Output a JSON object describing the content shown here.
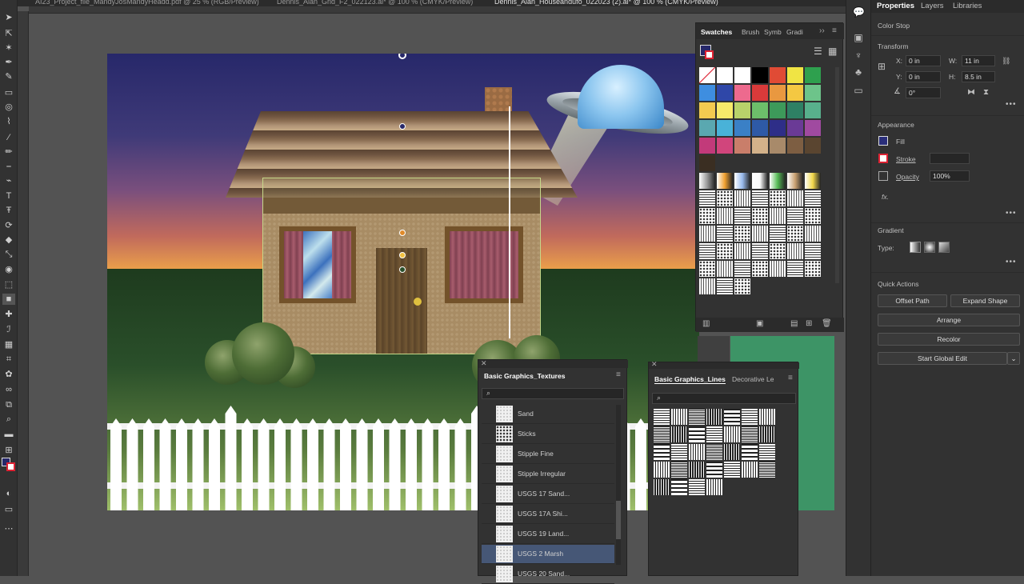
{
  "document_tabs": [
    {
      "label": "AI23_Project_file_MandyJosMandyHeadd.pdf @ 25 % (RGB/Preview)",
      "active": false
    },
    {
      "label": "Dennis_Alan_Grid_F2_022123.ai* @ 100 % (CMYK/Preview)",
      "active": false
    },
    {
      "label": "Dennis_Alan_Houseandufo_022023 (2).ai* @ 100 % (CMYK/Preview)",
      "active": true
    }
  ],
  "toolbar": {
    "tools": [
      "selection-tool",
      "direct-selection-tool",
      "magic-wand-tool",
      "pen-tool",
      "curvature-tool",
      "rectangle-tool",
      "ellipse-tool",
      "paintbrush-tool",
      "shaper-tool",
      "pencil-tool",
      "eraser-tool",
      "type-tool",
      "touch-type-tool",
      "rotate-tool",
      "scale-tool",
      "width-tool",
      "warp-tool",
      "free-transform-tool",
      "shape-builder-tool",
      "perspective-grid-tool",
      "mesh-tool",
      "gradient-tool",
      "eyedropper-tool",
      "blend-tool",
      "symbol-sprayer-tool",
      "column-graph-tool",
      "artboard-tool",
      "slice-tool",
      "hand-tool",
      "zoom-tool"
    ]
  },
  "properties_panel": {
    "tabs": [
      "Properties",
      "Layers",
      "Libraries"
    ],
    "selection_type": "Color Stop",
    "transform": {
      "title": "Transform",
      "x_label": "X:",
      "x_value": "0 in",
      "y_label": "Y:",
      "y_value": "0 in",
      "w_label": "W:",
      "w_value": "11 in",
      "h_label": "H:",
      "h_value": "8.5 in",
      "angle_value": "0°"
    },
    "appearance": {
      "title": "Appearance",
      "fill_label": "Fill",
      "stroke_label": "Stroke",
      "opacity_label": "Opacity",
      "opacity_value": "100%",
      "fx_label": "fx."
    },
    "gradient": {
      "title": "Gradient",
      "type_label": "Type:"
    },
    "quick_actions": {
      "title": "Quick Actions",
      "offset_path": "Offset Path",
      "expand_shape": "Expand Shape",
      "arrange": "Arrange",
      "recolor": "Recolor",
      "start_global_edit": "Start Global Edit"
    }
  },
  "swatches_panel": {
    "tabs": [
      "Swatches",
      "Brush",
      "Symb",
      "Gradi"
    ],
    "colors": [
      "#ffffff",
      "#ffffff",
      "#ffffff",
      "#000000",
      "#e04b35",
      "#f0e444",
      "#2ea04e",
      "#3e8ee0",
      "#2f47a8",
      "#ed6a8e",
      "#d93a3a",
      "#e99840",
      "#f4c842",
      "#6dc48a",
      "#f3cb50",
      "#f7ea6a",
      "#b8d26a",
      "#6dbf6a",
      "#3d9a5a",
      "#2e8064",
      "#58b08c",
      "#5aa8b0",
      "#49b2d8",
      "#3a80c6",
      "#2e5aa6",
      "#2e2e88",
      "#6a3a96",
      "#a04aa0",
      "#c23a7a",
      "#d1457c",
      "#c97e6a",
      "#d3b28a",
      "#a88a6a",
      "#7d5e42",
      "#5a4530",
      "#3a2e22"
    ],
    "gradient_swatches": [
      "#999999",
      "#f0a030",
      "#99bbee",
      "#fafafa",
      "#55bb55",
      "#c8a070",
      "#f2d84a"
    ]
  },
  "textures_panel": {
    "title": "Basic Graphics_Textures",
    "items": [
      {
        "name": "Sand",
        "selected": false
      },
      {
        "name": "Sticks",
        "selected": false
      },
      {
        "name": "Stipple Fine",
        "selected": false
      },
      {
        "name": "Stipple Irregular",
        "selected": false
      },
      {
        "name": "USGS 17 Sand...",
        "selected": false
      },
      {
        "name": "USGS 17A Shi...",
        "selected": false
      },
      {
        "name": "USGS 19 Land...",
        "selected": false
      },
      {
        "name": "USGS 2 Marsh",
        "selected": true
      },
      {
        "name": "USGS 20 Sand...",
        "selected": false
      }
    ]
  },
  "lines_panel": {
    "title": "Basic Graphics_Lines",
    "second_tab": "Decorative Le"
  },
  "canvas": {
    "accent_selection": "#c6d88a",
    "sky_top": "#27286a",
    "sky_bottom": "#f5c45a",
    "grass": "#2a4f2a"
  }
}
